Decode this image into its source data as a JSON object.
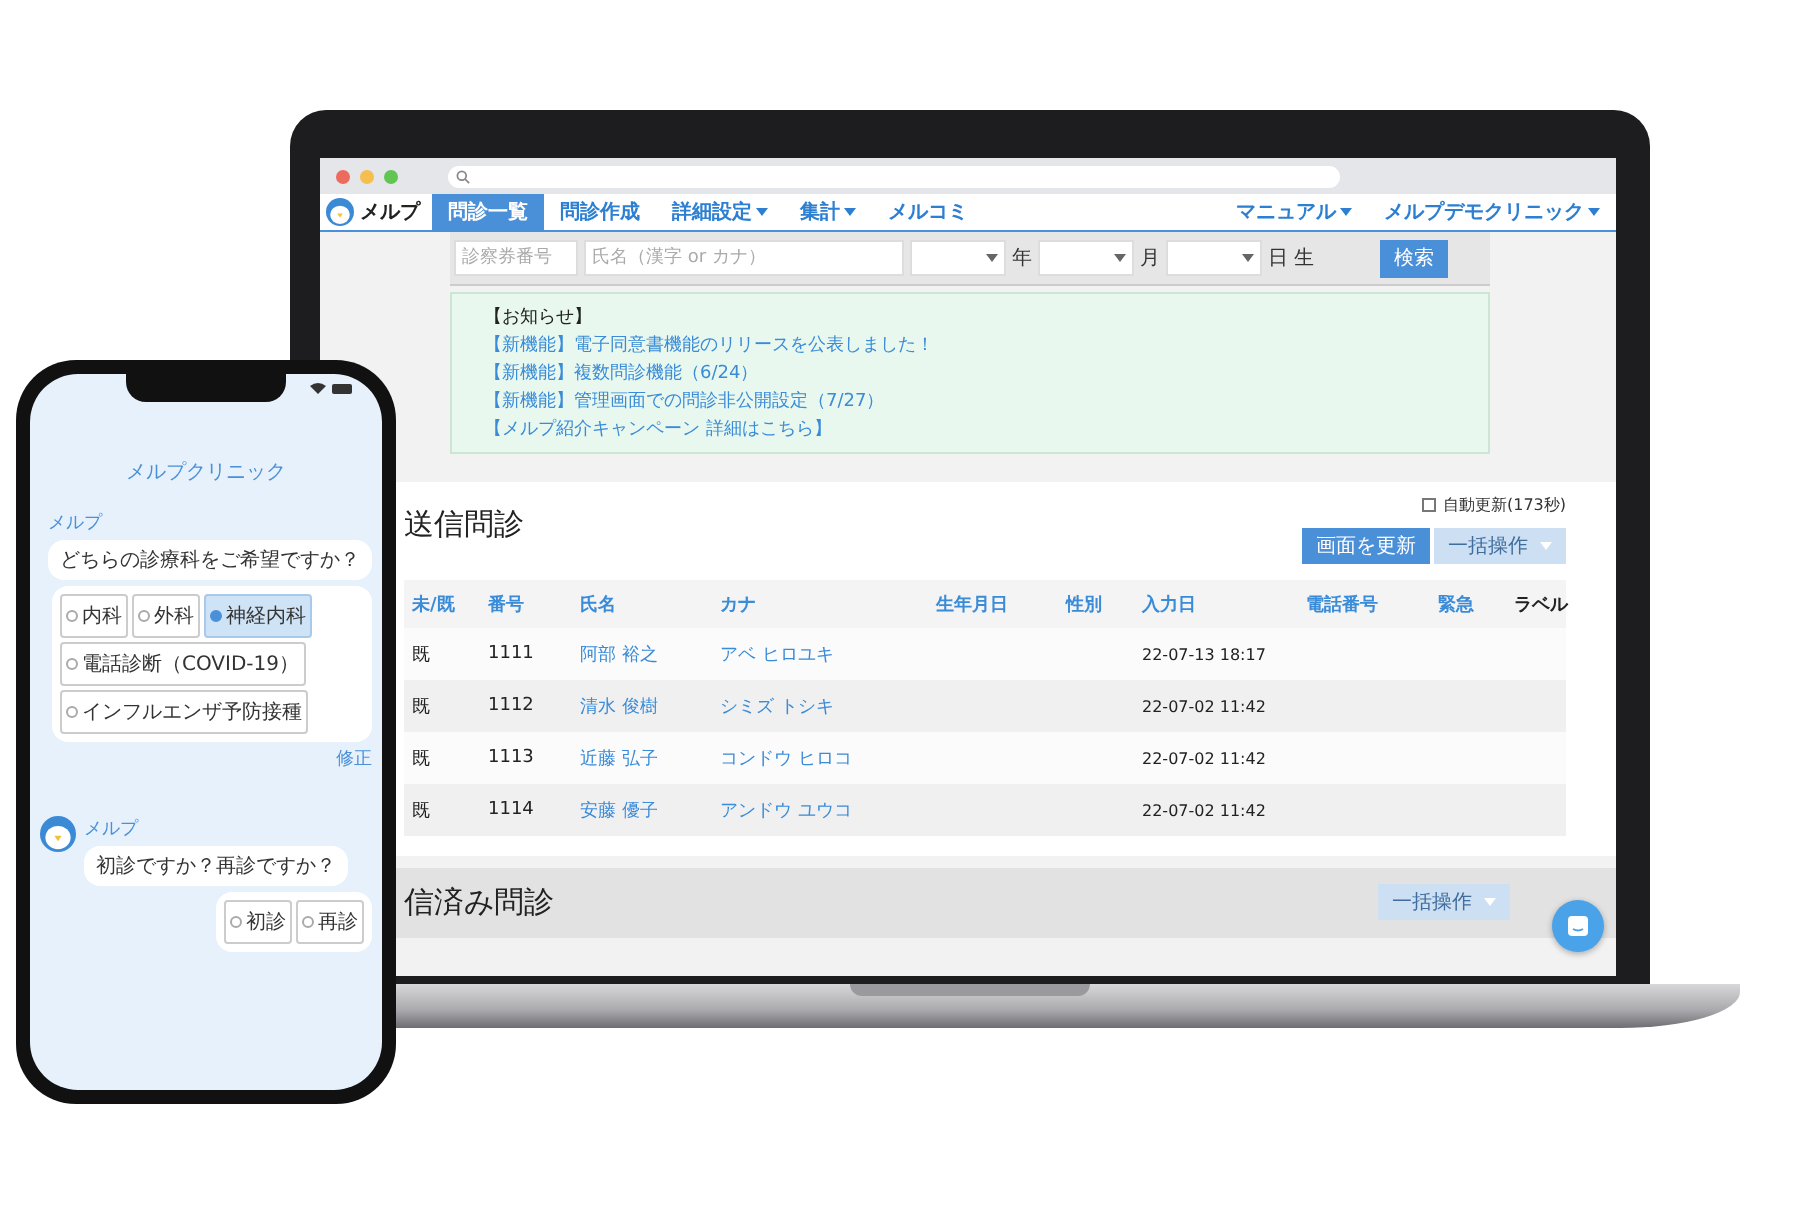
{
  "app": {
    "logo": "メルプ",
    "nav": [
      {
        "label": "問診一覧",
        "selected": true,
        "dropdown": false
      },
      {
        "label": "問診作成",
        "selected": false,
        "dropdown": false
      },
      {
        "label": "詳細設定",
        "selected": false,
        "dropdown": true
      },
      {
        "label": "集計",
        "selected": false,
        "dropdown": true
      },
      {
        "label": "メルコミ",
        "selected": false,
        "dropdown": false
      }
    ],
    "nav_right": [
      {
        "label": "マニュアル",
        "dropdown": true
      },
      {
        "label": "メルプデモクリニック",
        "dropdown": true
      }
    ]
  },
  "search": {
    "card_number": {
      "placeholder": "診察券番号"
    },
    "name": {
      "placeholder": "氏名（漢字 or カナ）"
    },
    "birth": [
      {
        "unit": "年"
      },
      {
        "unit": "月"
      },
      {
        "unit": "日 生"
      }
    ],
    "button": "検索"
  },
  "notice": {
    "title": "【お知らせ】",
    "links": [
      "【新機能】電子同意書機能のリリースを公表しました！",
      "【新機能】複数問診機能（6/24）",
      "【新機能】管理画面での問診非公開設定（7/27）",
      "【メルプ紹介キャンペーン 詳細はこちら】"
    ]
  },
  "unsent": {
    "title": "送信問診",
    "auto_refresh": {
      "label": "自動更新(173秒)",
      "checked": false
    },
    "buttons": [
      {
        "label": "画面を更新",
        "disabled": false,
        "dropdown": false
      },
      {
        "label": "一括操作",
        "disabled": true,
        "dropdown": true
      }
    ],
    "table": {
      "columns": [
        {
          "label": "未/既",
          "link": true
        },
        {
          "label": "番号",
          "link": true
        },
        {
          "label": "氏名",
          "link": true
        },
        {
          "label": "カナ",
          "link": true
        },
        {
          "label": "生年月日",
          "link": true
        },
        {
          "label": "性別",
          "link": true
        },
        {
          "label": "入力日",
          "link": true
        },
        {
          "label": "電話番号",
          "link": true
        },
        {
          "label": "緊急",
          "link": true
        },
        {
          "label": "ラベル",
          "link": false
        }
      ],
      "rows": [
        {
          "status": "既",
          "number": "1111",
          "name": "阿部 裕之",
          "kana": "アベ ヒロユキ",
          "input_date": "22-07-13 18:17"
        },
        {
          "status": "既",
          "number": "1112",
          "name": "清水 俊樹",
          "kana": "シミズ トシキ",
          "input_date": "22-07-02 11:42"
        },
        {
          "status": "既",
          "number": "1113",
          "name": "近藤 弘子",
          "kana": "コンドウ ヒロコ",
          "input_date": "22-07-02 11:42"
        },
        {
          "status": "既",
          "number": "1114",
          "name": "安藤 優子",
          "kana": "アンドウ ユウコ",
          "input_date": "22-07-02 11:42"
        }
      ]
    }
  },
  "sent": {
    "title": "信済み問診",
    "buttons": [
      {
        "label": "一括操作",
        "disabled": true,
        "dropdown": true
      }
    ]
  },
  "phone": {
    "title": "メルプクリニック",
    "messages": [
      {
        "sender": "メルプ",
        "text": "どちらの診療科をご希望ですか？",
        "options": [
          {
            "label": "内科",
            "selected": false
          },
          {
            "label": "外科",
            "selected": false
          },
          {
            "label": "神経内科",
            "selected": true
          },
          {
            "label": "電話診断（COVID-19）",
            "selected": false
          },
          {
            "label": "インフルエンザ予防接種",
            "selected": false
          }
        ],
        "edit_link": "修正"
      },
      {
        "sender": "メルプ",
        "text": "初診ですか？再診ですか？",
        "options": [
          {
            "label": "初診",
            "selected": false
          },
          {
            "label": "再診",
            "selected": false
          }
        ]
      }
    ]
  }
}
